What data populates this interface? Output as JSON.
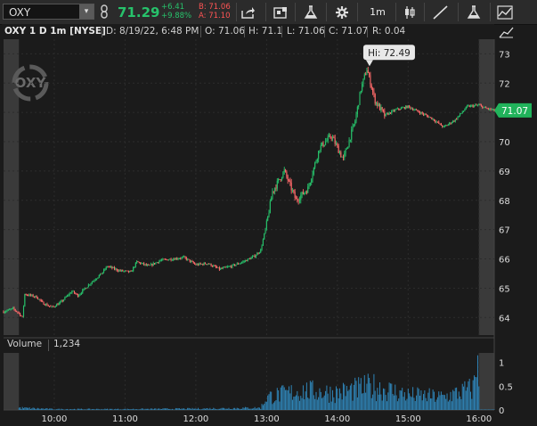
{
  "toolbar": {
    "symbol": "OXY",
    "dropdown_glyph": "▾",
    "last_price": "71.29",
    "net_change": "+6.41",
    "pct_change": "+9.88%",
    "bid": "B: 71.06",
    "ask": "A: 71.10",
    "timeframe": "1m",
    "icons": [
      "share-icon",
      "active-trader-icon",
      "studies-flask-icon",
      "settings-gear-icon",
      "candle-style-icon",
      "drawing-line-icon",
      "strategies-flask-icon",
      "drawings-menu-icon"
    ]
  },
  "header": {
    "title": "OXY 1 D 1m [NYSE]",
    "date": "D: 8/19/22, 6:48 PM",
    "open": "O: 71.06",
    "high": "H: 71.1",
    "low": "L: 71.06",
    "close": "C: 71.07",
    "range": "R: 0.04"
  },
  "watermark": "OXY",
  "volume_header": {
    "label": "Volume",
    "value": "1,234"
  },
  "colors": {
    "up": "#27c26b",
    "down": "#ff6a6a",
    "volume": "#2f85b8",
    "grid": "#2c2c2c",
    "bg": "#1b1b1b",
    "shade": "#3a3a3a"
  },
  "chart_data": [
    {
      "type": "candlestick",
      "title": "OXY 1 D 1m [NYSE]",
      "interval": "1m",
      "x_ticks": [
        "10:00",
        "11:00",
        "12:00",
        "13:00",
        "14:00",
        "15:00",
        "16:00"
      ],
      "y_ticks": [
        64,
        65,
        66,
        67,
        68,
        69,
        70,
        71,
        72,
        73
      ],
      "ylim": [
        63.4,
        73.5
      ],
      "xlim": [
        "09:17",
        "16:13"
      ],
      "extended_hours": [
        [
          "09:17",
          "09:30"
        ],
        [
          "16:00",
          "16:13"
        ]
      ],
      "high_annotation": {
        "label": "Hi: 72.49",
        "time": "14:25",
        "value": 72.49
      },
      "last_price_label": "71.07",
      "last_price": 71.07,
      "price_path": [
        [
          "09:17",
          64.2
        ],
        [
          "09:25",
          64.3
        ],
        [
          "09:30",
          64.15
        ],
        [
          "09:33",
          64.0
        ],
        [
          "09:35",
          64.8
        ],
        [
          "09:45",
          64.7
        ],
        [
          "09:50",
          64.5
        ],
        [
          "09:58",
          64.35
        ],
        [
          "10:05",
          64.5
        ],
        [
          "10:10",
          64.7
        ],
        [
          "10:15",
          64.9
        ],
        [
          "10:20",
          64.75
        ],
        [
          "10:30",
          65.15
        ],
        [
          "10:40",
          65.5
        ],
        [
          "10:45",
          65.75
        ],
        [
          "10:55",
          65.6
        ],
        [
          "11:05",
          65.55
        ],
        [
          "11:10",
          65.9
        ],
        [
          "11:20",
          65.75
        ],
        [
          "11:30",
          65.95
        ],
        [
          "11:40",
          66.0
        ],
        [
          "11:50",
          66.05
        ],
        [
          "12:00",
          65.8
        ],
        [
          "12:10",
          65.85
        ],
        [
          "12:20",
          65.65
        ],
        [
          "12:30",
          65.75
        ],
        [
          "12:40",
          65.9
        ],
        [
          "12:50",
          66.1
        ],
        [
          "12:55",
          66.3
        ],
        [
          "13:00",
          67.2
        ],
        [
          "13:05",
          68.3
        ],
        [
          "13:15",
          69.0
        ],
        [
          "13:25",
          68.0
        ],
        [
          "13:35",
          68.4
        ],
        [
          "13:45",
          69.8
        ],
        [
          "13:55",
          70.2
        ],
        [
          "14:05",
          69.4
        ],
        [
          "14:15",
          70.7
        ],
        [
          "14:20",
          71.8
        ],
        [
          "14:25",
          72.49
        ],
        [
          "14:32",
          71.4
        ],
        [
          "14:40",
          70.9
        ],
        [
          "14:50",
          71.1
        ],
        [
          "15:00",
          71.2
        ],
        [
          "15:10",
          71.0
        ],
        [
          "15:20",
          70.8
        ],
        [
          "15:30",
          70.5
        ],
        [
          "15:40",
          70.75
        ],
        [
          "15:50",
          71.2
        ],
        [
          "16:00",
          71.25
        ],
        [
          "16:05",
          71.15
        ],
        [
          "16:13",
          71.07
        ]
      ]
    },
    {
      "type": "bar",
      "title": "Volume",
      "y_ticks": [
        "0",
        "0.5",
        "1"
      ],
      "ylim": [
        0,
        1.2
      ],
      "volume_profile": [
        [
          "09:30",
          0.05
        ],
        [
          "10:00",
          0.02
        ],
        [
          "11:00",
          0.02
        ],
        [
          "12:00",
          0.03
        ],
        [
          "12:55",
          0.05
        ],
        [
          "13:00",
          0.3
        ],
        [
          "13:30",
          0.45
        ],
        [
          "14:00",
          0.4
        ],
        [
          "14:30",
          0.55
        ],
        [
          "15:00",
          0.35
        ],
        [
          "15:30",
          0.3
        ],
        [
          "15:55",
          0.5
        ],
        [
          "15:59",
          1.15
        ],
        [
          "16:05",
          0.02
        ]
      ]
    }
  ]
}
